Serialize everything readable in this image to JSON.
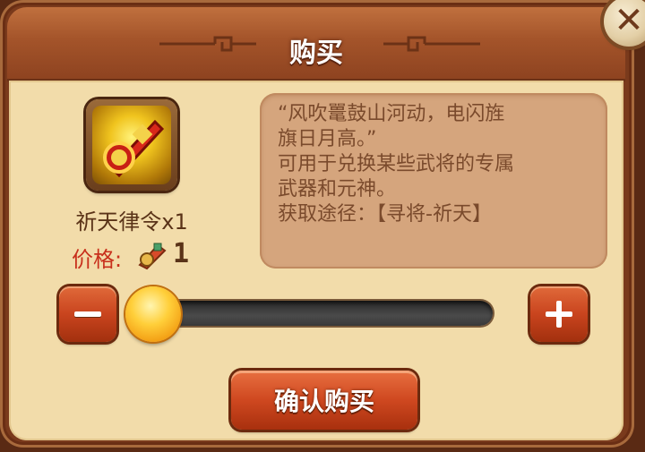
{
  "dialog": {
    "title": "购买",
    "close_icon": "close-icon"
  },
  "item": {
    "name": "祈天律令x1",
    "icon": "token-icon",
    "price_label": "价格:",
    "price_value": "1",
    "price_icon": "currency-icon"
  },
  "description": {
    "lines": [
      "“风吹鼍鼓山河动，电闪旌",
      "旗日月高。”",
      "可用于兑换某些武将的专属",
      "武器和元神。",
      "获取途径：【寻将-祈天】"
    ]
  },
  "quantity": {
    "minus_icon": "minus-icon",
    "plus_icon": "plus-icon",
    "slider_level": 0
  },
  "confirm_label": "确认购买",
  "colors": {
    "frame": "#7a3a1c",
    "panel": "#f2dcaa",
    "button": "#cf4820",
    "price_label": "#c8301c"
  }
}
